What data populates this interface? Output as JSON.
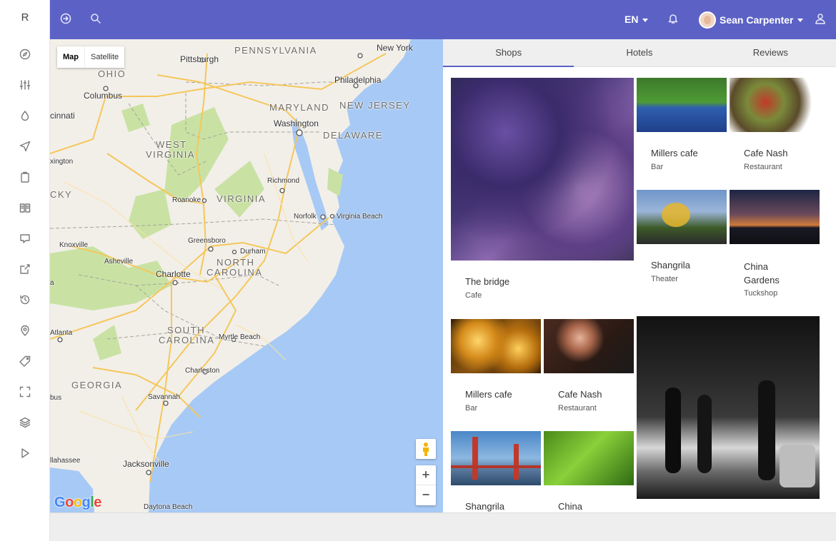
{
  "app": {
    "logo_letter": "R"
  },
  "topbar": {
    "language": "EN",
    "user_name": "Sean Carpenter"
  },
  "map": {
    "type_buttons": [
      "Map",
      "Satellite"
    ],
    "zoom_in": "+",
    "zoom_out": "−",
    "brand": "Google",
    "labels": {
      "pennsylvania": "PENNSYLVANIA",
      "new_york": "New York",
      "ohio": "OHIO",
      "pittsburgh": "Pittsburgh",
      "columbus": "Columbus",
      "cincinnati": "cinnati",
      "philadelphia": "Philadelphia",
      "maryland": "MARYLAND",
      "new_jersey": "NEW JERSEY",
      "washington": "Washington",
      "delaware": "DELAWARE",
      "west_virginia_1": "WEST",
      "west_virginia_2": "VIRGINIA",
      "lexington": "xington",
      "richmond": "Richmond",
      "kentucky": "CKY",
      "roanoke": "Roanoke",
      "virginia": "VIRGINIA",
      "norfolk": "Norfolk",
      "virginia_beach": "Virginia Beach",
      "knoxville": "Knoxville",
      "greensboro": "Greensboro",
      "asheville": "Asheville",
      "durham": "Durham",
      "north_carolina_1": "NORTH",
      "north_carolina_2": "CAROLINA",
      "charlotte": "Charlotte",
      "ga_edge": "a",
      "atlanta": "Atlanta",
      "south_carolina_1": "SOUTH",
      "south_carolina_2": "CAROLINA",
      "myrtle_beach": "Myrtle Beach",
      "charleston": "Charleston",
      "georgia": "GEORGIA",
      "columbus_ga": "bus",
      "savannah": "Savannah",
      "tallahassee": "llahassee",
      "jacksonville": "Jacksonville",
      "daytona": "Daytona Beach"
    }
  },
  "tabs": [
    "Shops",
    "Hotels",
    "Reviews"
  ],
  "cards": [
    {
      "title": "The bridge",
      "category": "Cafe"
    },
    {
      "title": "Millers cafe",
      "category": "Bar"
    },
    {
      "title": "Cafe Nash",
      "category": "Restaurant"
    },
    {
      "title": "Shangrila",
      "category": "Theater"
    },
    {
      "title": "China Gardens",
      "category": "Tuckshop"
    },
    {
      "title": "Millers cafe",
      "category": "Bar"
    },
    {
      "title": "Cafe Nash",
      "category": "Restaurant"
    },
    {
      "title": "Shangrila",
      "category": ""
    },
    {
      "title": "China",
      "category": ""
    }
  ],
  "colors": {
    "topbar": "#5c62c5",
    "water": "#a7c9f5",
    "land": "#f2efe9",
    "park": "#c9e2a4",
    "highway": "#f5c75a"
  }
}
